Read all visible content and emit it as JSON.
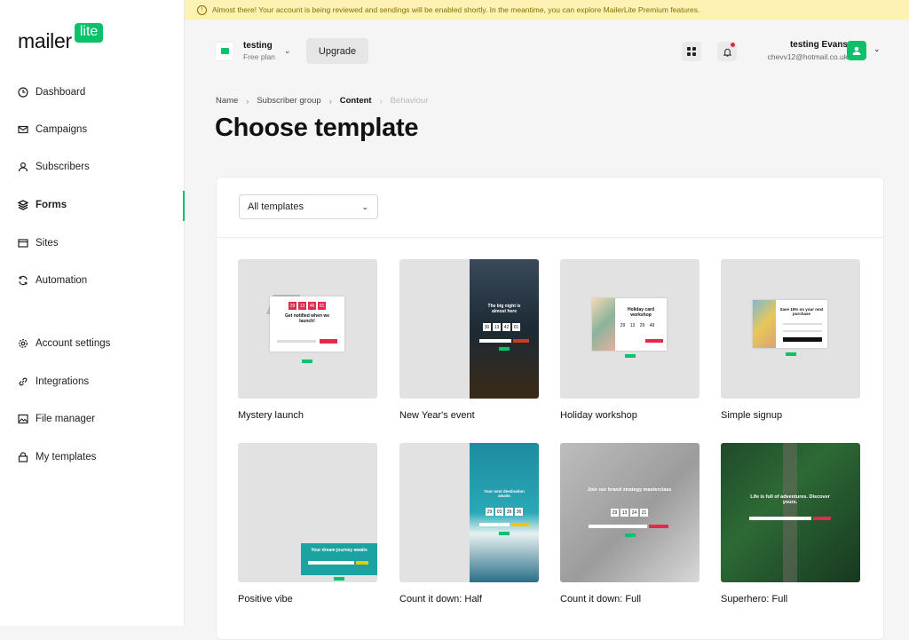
{
  "brand": {
    "logo_main": "mailer",
    "logo_tag": "lite"
  },
  "sidebar": {
    "items": [
      {
        "label": "Dashboard",
        "icon": "clock-icon"
      },
      {
        "label": "Campaigns",
        "icon": "mail-icon"
      },
      {
        "label": "Subscribers",
        "icon": "user-icon"
      },
      {
        "label": "Forms",
        "icon": "layers-icon",
        "active": true
      },
      {
        "label": "Sites",
        "icon": "browser-icon"
      },
      {
        "label": "Automation",
        "icon": "refresh-icon"
      },
      {
        "label": "Account settings",
        "icon": "gear-icon"
      },
      {
        "label": "Integrations",
        "icon": "link-icon"
      },
      {
        "label": "File manager",
        "icon": "image-icon"
      },
      {
        "label": "My templates",
        "icon": "lock-icon"
      }
    ]
  },
  "banner": {
    "text": "Almost there! Your account is being reviewed and sendings will be enabled shortly. In the meantime, you can explore MailerLite Premium features."
  },
  "topbar": {
    "account_name": "testing",
    "account_plan": "Free plan",
    "upgrade_label": "Upgrade",
    "user_name": "testing Evans",
    "user_email": "chevv12@hotmail.co.uk"
  },
  "breadcrumb": [
    "Name",
    "Subscriber group",
    "Content",
    "Behaviour"
  ],
  "page_title": "Choose template",
  "filter": {
    "selected": "All templates"
  },
  "templates": [
    {
      "name": "Mystery launch",
      "headline": "Get notified when we launch!",
      "countdown": [
        "29",
        "13",
        "46",
        "01"
      ]
    },
    {
      "name": "New Year's event",
      "headline": "The big night is almost here",
      "countdown": [
        "30",
        "13",
        "42",
        "01"
      ]
    },
    {
      "name": "Holiday workshop",
      "headline": "Holiday card workshop",
      "countdown": [
        "29",
        "13",
        "29",
        "49"
      ]
    },
    {
      "name": "Simple signup",
      "headline": "Save 15% on your next purchase"
    },
    {
      "name": "Positive vibe",
      "headline": "Your dream journey awaits"
    },
    {
      "name": "Count it down: Half",
      "headline": "Your next destination awaits",
      "countdown": [
        "29",
        "03",
        "39",
        "36"
      ]
    },
    {
      "name": "Count it down: Full",
      "headline": "Join our brand strategy masterclass",
      "countdown": [
        "29",
        "13",
        "24",
        "21"
      ]
    },
    {
      "name": "Superhero: Full",
      "headline": "Life is full of adventures. Discover yours."
    }
  ],
  "colors": {
    "brand_green": "#09c269",
    "banner_bg": "#fdf2b3",
    "notification": "#e5293d"
  }
}
